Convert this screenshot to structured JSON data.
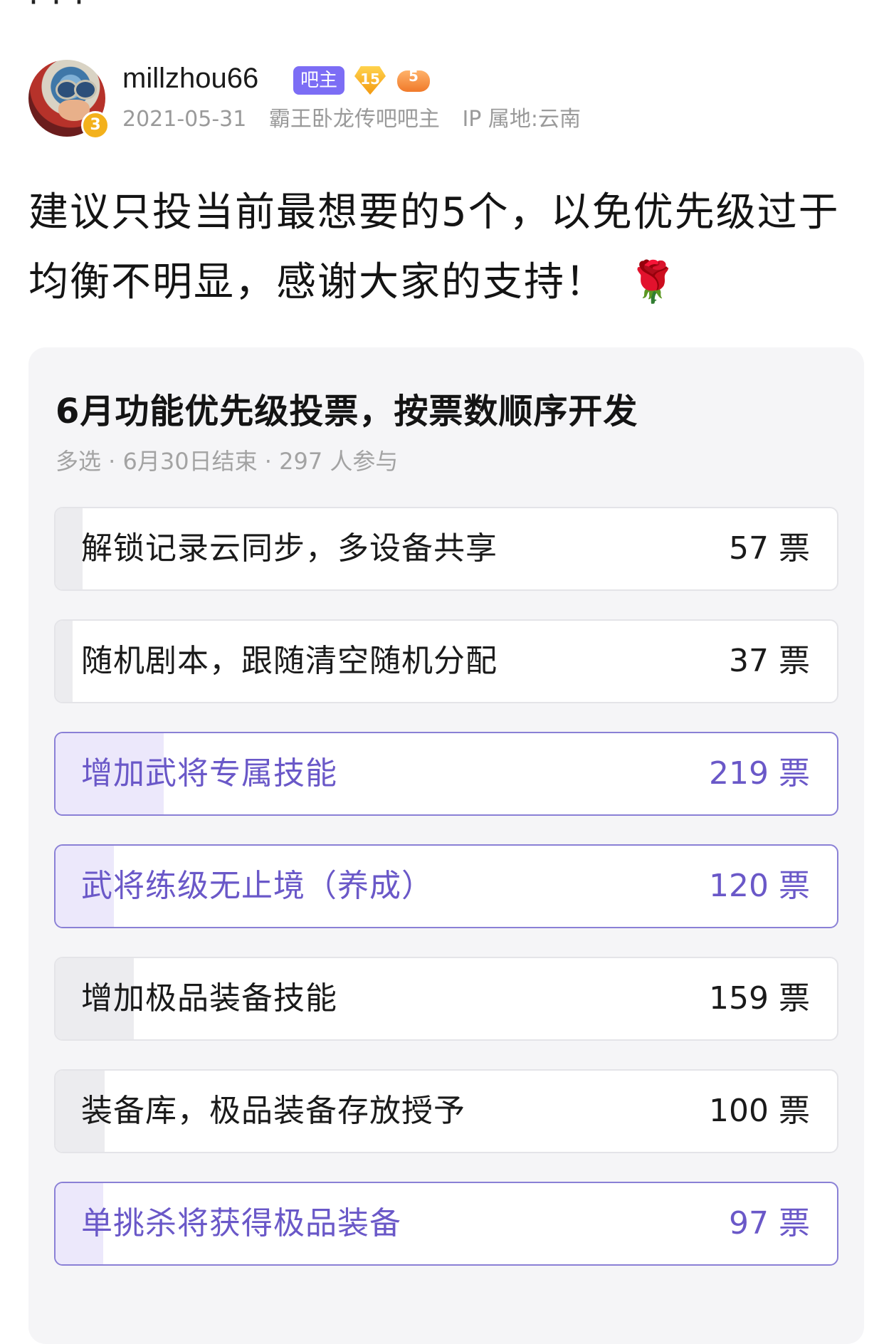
{
  "author": {
    "avatar_level": "3",
    "username": "millzhou66",
    "role_badge": "吧主",
    "level_badge": "15",
    "game_badge": "5",
    "date": "2021-05-31",
    "title": "霸王卧龙传吧吧主",
    "ip_location": "IP 属地:云南"
  },
  "post": {
    "text": "建议只投当前最想要的5个，以免优先级过于均衡不明显，感谢大家的支持！",
    "emoji": "🌹"
  },
  "poll": {
    "title": "6月功能优先级投票，按票数顺序开发",
    "subtitle": "多选 · 6月30日结束 · 297 人参与",
    "options": [
      {
        "label": "解锁记录云同步，多设备共享",
        "votes": "57 票",
        "selected": false,
        "fraction": 0.035
      },
      {
        "label": "随机剧本，跟随清空随机分配",
        "votes": "37 票",
        "selected": false,
        "fraction": 0.022
      },
      {
        "label": "增加武将专属技能",
        "votes": "219 票",
        "selected": true,
        "fraction": 0.138
      },
      {
        "label": "武将练级无止境（养成）",
        "votes": "120 票",
        "selected": true,
        "fraction": 0.075
      },
      {
        "label": "增加极品装备技能",
        "votes": "159 票",
        "selected": false,
        "fraction": 0.1
      },
      {
        "label": "装备库，极品装备存放授予",
        "votes": "100 票",
        "selected": false,
        "fraction": 0.063
      },
      {
        "label": "单挑杀将获得极品装备",
        "votes": "97 票",
        "selected": true,
        "fraction": 0.061
      }
    ]
  },
  "colors": {
    "accent": "#7c6df5",
    "selected_text": "#6a58c8",
    "selected_border": "#8a80d6"
  }
}
